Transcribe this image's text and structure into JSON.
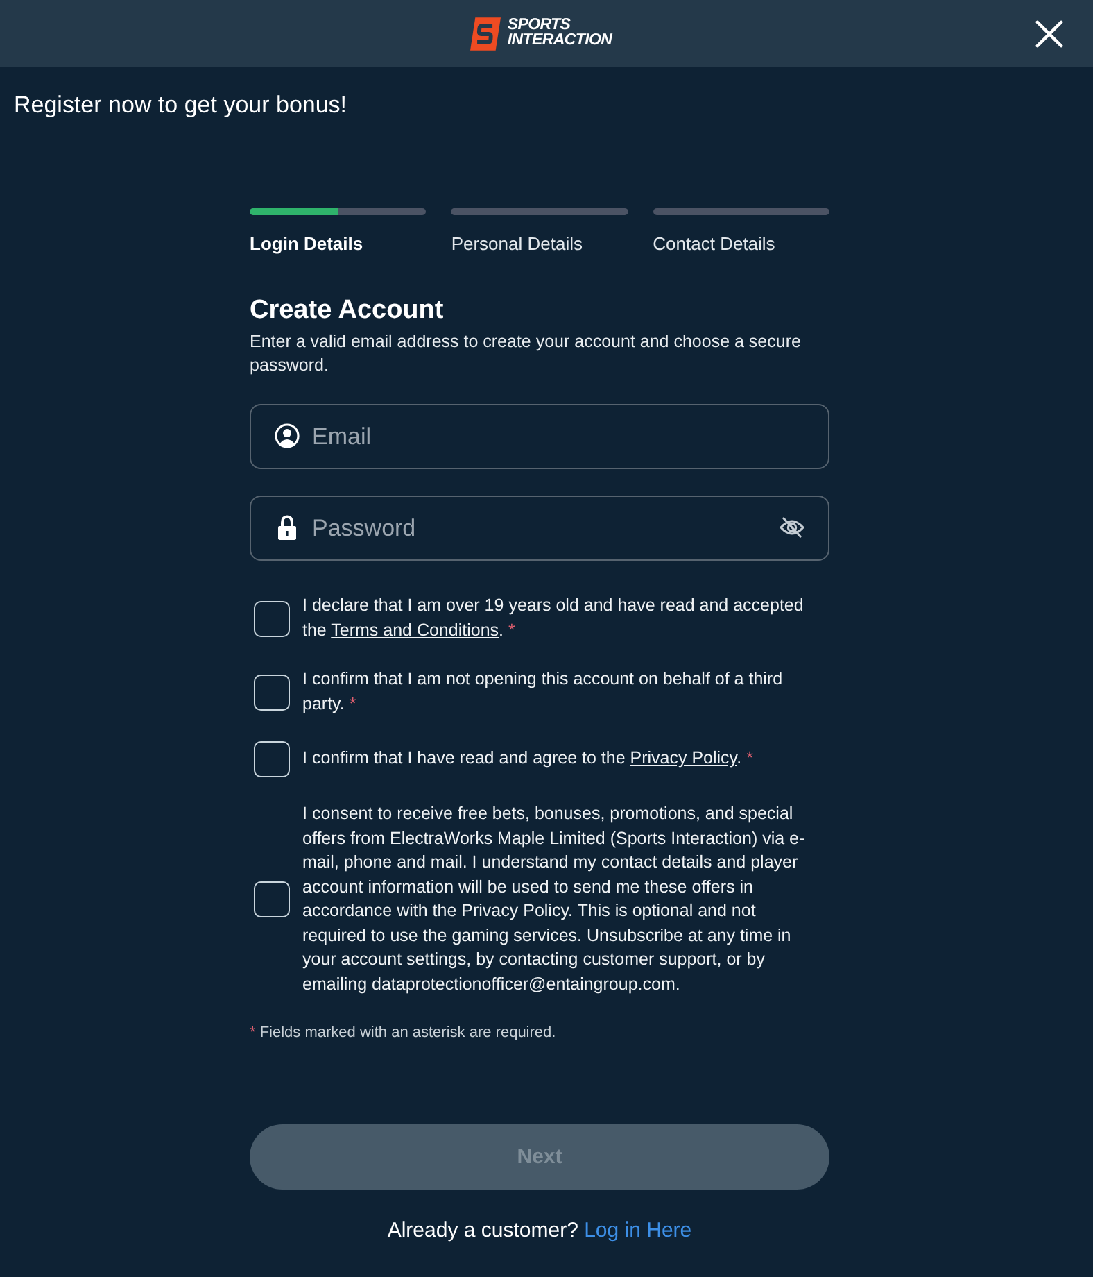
{
  "header": {
    "logo": {
      "line_1": "SPORTS",
      "line_2": "INTERACTION"
    }
  },
  "title": "Register now to get your bonus!",
  "steps": [
    {
      "label": "Login Details",
      "selected": true,
      "level": 0.5
    },
    {
      "label": "Personal Details",
      "selected": false,
      "level": 0
    },
    {
      "label": "Contact Details",
      "selected": false,
      "level": 0
    }
  ],
  "form": {
    "heading": "Create Account",
    "description": "Enter a valid email address to create your account and choose a secure password."
  },
  "fields": [
    {
      "kind": "email",
      "placeholder": "Email"
    },
    {
      "kind": "password",
      "placeholder": "Password"
    }
  ],
  "checkboxes": [
    {
      "text_before": "I declare that I am over 19 years old and have read and accepted the ",
      "link": "Terms and Conditions",
      "text_after": ".",
      "required_mark": "*",
      "checked": false
    },
    {
      "text_before": "I confirm that I am not opening this account on behalf of a third party.",
      "required_mark": "*",
      "checked": false
    },
    {
      "text_before": "I confirm that I have read and agree to the ",
      "link": "Privacy Policy",
      "text_after": ".",
      "required_mark": "*",
      "checked": false
    },
    {
      "text_before": "I consent to receive free bets, bonuses, promotions, and special offers from ElectraWorks Maple Limited (Sports Interaction) via e-mail, phone and mail. I understand my contact details and player account information will be used to send me these offers in accordance with the Privacy Policy. This is optional and not required to use the gaming services. Unsubscribe at any time in your account settings, by contacting customer support, or by emailing dataprotectionofficer@entaingroup.com.",
      "checked": false
    }
  ],
  "footnote": {
    "mark": "*",
    "text": "Fields marked with an asterisk are required."
  },
  "next_button": {
    "label": "Next",
    "disabled": true
  },
  "login_prompt": {
    "text": "Already a customer?",
    "link": "Log in Here"
  }
}
